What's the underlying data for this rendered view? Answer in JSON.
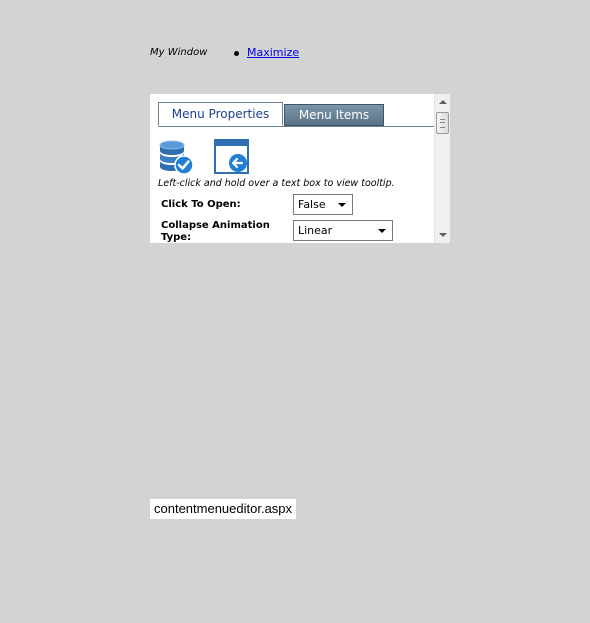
{
  "window": {
    "title": "My Window",
    "links": [
      {
        "label": "Maximize"
      }
    ]
  },
  "panel": {
    "tabs": [
      {
        "label": "Menu Properties",
        "active": true
      },
      {
        "label": "Menu Items",
        "active": false
      }
    ],
    "icons": [
      "database-check-icon",
      "window-back-icon"
    ],
    "hint": "Left-click and hold over a text box to view tooltip.",
    "fields": {
      "click_to_open": {
        "label": "Click To Open:",
        "value": "False"
      },
      "collapse_animation": {
        "label": "Collapse Animation Type:",
        "value": "Linear"
      }
    }
  },
  "status_bar": {
    "text": "contentmenueditor.aspx"
  },
  "colors": {
    "background": "#d3d3d3",
    "tab_active_text": "#1a3f8f",
    "tab_inactive_bg": "#5b7387",
    "link": "#0000ee"
  }
}
